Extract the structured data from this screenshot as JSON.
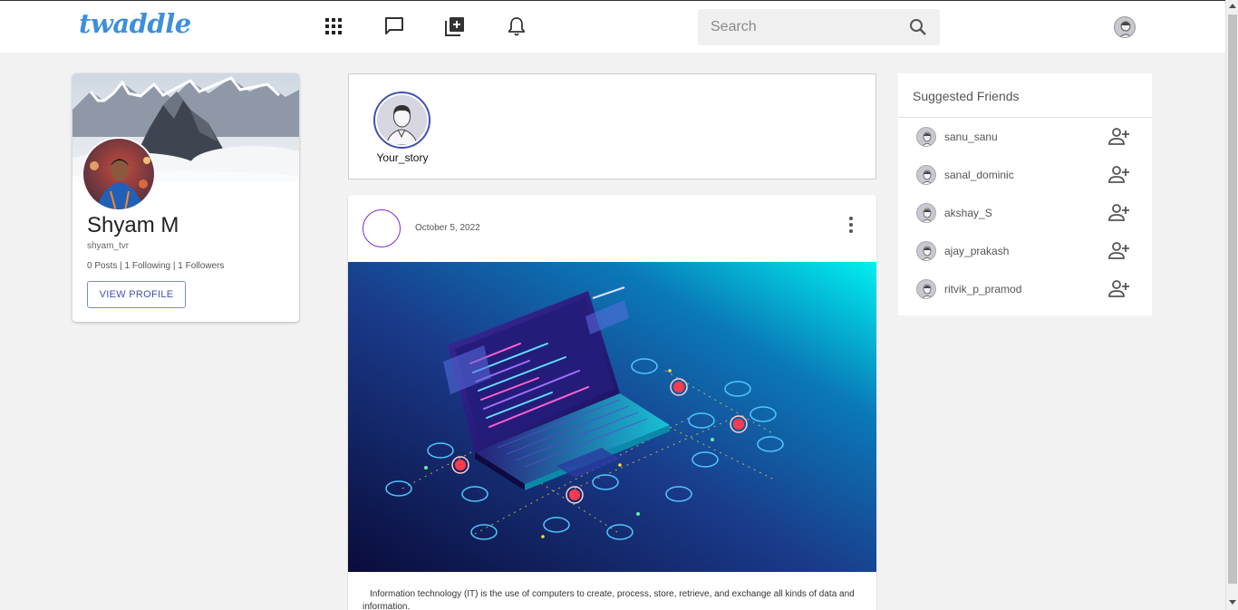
{
  "app": {
    "logo": "twaddle"
  },
  "nav": {
    "icons": [
      "grid-icon",
      "chat-icon",
      "add-post-icon",
      "bell-icon"
    ]
  },
  "search": {
    "placeholder": "Search",
    "value": ""
  },
  "profile": {
    "name": "Shyam M",
    "username": "shyam_tvr",
    "stats": "0 Posts | 1 Following | 1 Followers",
    "button": "VIEW PROFILE"
  },
  "stories": {
    "own_label": "Your_story"
  },
  "post": {
    "date": "October 5, 2022",
    "text": "Information technology (IT) is the use of computers to create, process, store, retrieve, and exchange all kinds of data and information."
  },
  "suggested": {
    "title": "Suggested Friends",
    "friends": [
      {
        "name": "sanu_sanu"
      },
      {
        "name": "sanal_dominic"
      },
      {
        "name": "akshay_S"
      },
      {
        "name": "ajay_prakash"
      },
      {
        "name": "ritvik_p_pramod"
      }
    ]
  },
  "colors": {
    "accent": "#3f51b5",
    "logo": "#3d8fdc",
    "post_avatar_ring": "#7b2ad9"
  }
}
